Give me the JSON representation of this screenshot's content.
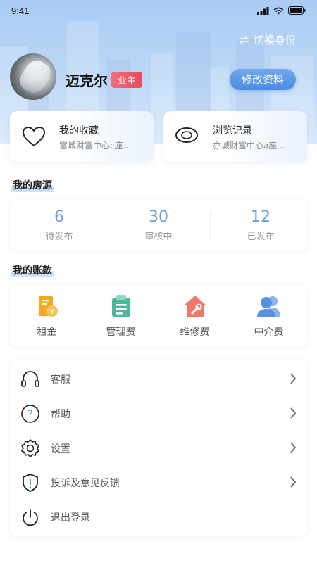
{
  "status_bar": {
    "time": "9:41"
  },
  "header": {
    "switch_identity": "切换身份",
    "username": "迈克尔",
    "role_badge": "业主",
    "edit_profile": "修改资料"
  },
  "quick_cards": [
    {
      "title": "我的收藏",
      "subtitle": "富城财富中心c座..."
    },
    {
      "title": "浏览记录",
      "subtitle": "亦城财富中心a座..."
    }
  ],
  "my_listings": {
    "title": "我的房源",
    "stats": [
      {
        "value": "6",
        "label": "待发布"
      },
      {
        "value": "30",
        "label": "审核中"
      },
      {
        "value": "12",
        "label": "已发布"
      }
    ]
  },
  "my_account": {
    "title": "我的账款",
    "items": [
      {
        "label": "租金",
        "icon": "rent-icon"
      },
      {
        "label": "管理费",
        "icon": "management-fee-icon"
      },
      {
        "label": "维修费",
        "icon": "repair-fee-icon"
      },
      {
        "label": "中介费",
        "icon": "agency-fee-icon"
      }
    ]
  },
  "menu": [
    {
      "label": "客服",
      "icon": "headset-icon"
    },
    {
      "label": "帮助",
      "icon": "help-icon"
    },
    {
      "label": "设置",
      "icon": "gear-icon"
    },
    {
      "label": "投诉及意见反馈",
      "icon": "shield-icon"
    },
    {
      "label": "退出登录",
      "icon": "power-icon"
    }
  ],
  "colors": {
    "accent": "#4b8be0",
    "stat_number": "#6f9fd8",
    "badge": "#e94a58",
    "rent": "#f5a623",
    "management": "#4cb89a",
    "repair": "#f0776a",
    "agency": "#5b8fe0"
  }
}
